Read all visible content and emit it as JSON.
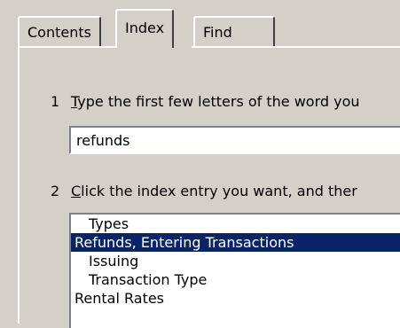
{
  "tabs": [
    {
      "label": "Contents",
      "active": false
    },
    {
      "label": "Index",
      "active": true
    },
    {
      "label": "Find",
      "active": false
    }
  ],
  "steps": {
    "step1": {
      "number": "1",
      "first_letter": "T",
      "rest": "ype the first few letters of the word you"
    },
    "step2": {
      "number": "2",
      "first_letter": "C",
      "rest": "lick the index entry you want, and ther"
    }
  },
  "search": {
    "value": "refunds"
  },
  "index_list": [
    {
      "label": "Types",
      "level": 1,
      "selected": false
    },
    {
      "label": "Refunds, Entering Transactions",
      "level": 0,
      "selected": true
    },
    {
      "label": "Issuing",
      "level": 1,
      "selected": false
    },
    {
      "label": "Transaction Type",
      "level": 1,
      "selected": false
    },
    {
      "label": "Rental Rates",
      "level": 0,
      "selected": false
    }
  ],
  "colors": {
    "selection": "#0a246a",
    "face": "#d4d0c8"
  }
}
